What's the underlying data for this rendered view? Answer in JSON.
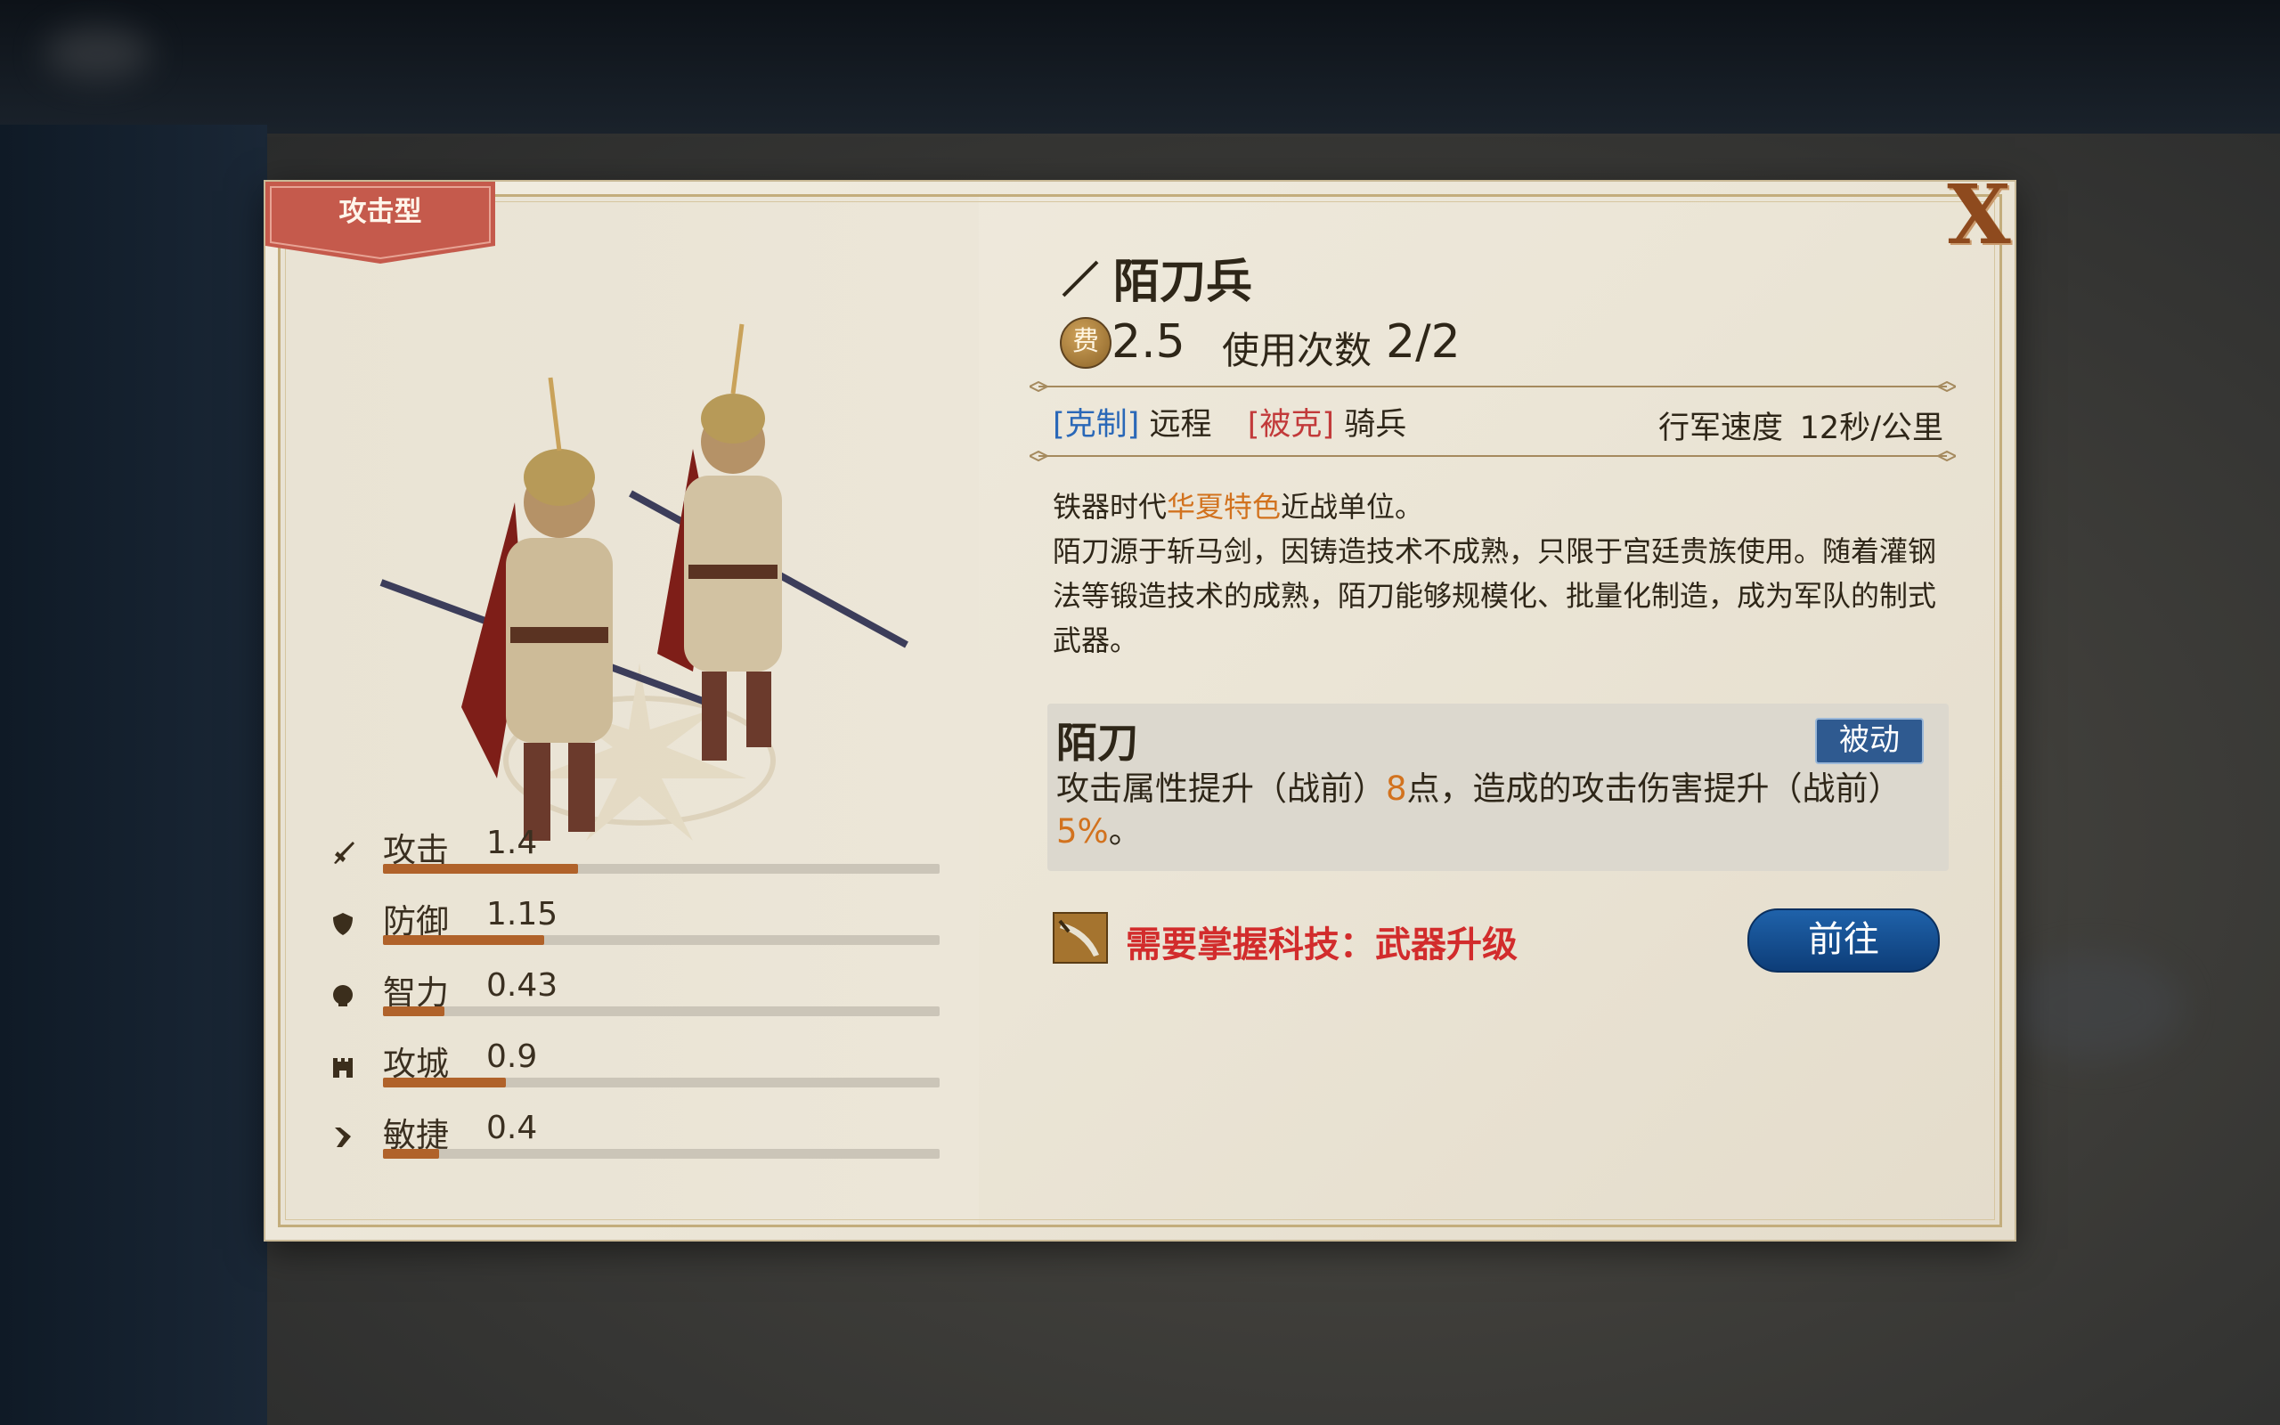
{
  "unit": {
    "type_label": "攻击型",
    "name": "陌刀兵",
    "cost_icon": "费",
    "cost": "2.5",
    "uses_label": "使用次数",
    "uses_value": "2/2",
    "counters_tag": "[克制]",
    "counters_target": "远程",
    "countered_tag": "[被克]",
    "countered_target": "骑兵",
    "speed_label": "行军速度",
    "speed_value": "12秒/公里"
  },
  "description": {
    "line1_pre": "铁器时代",
    "line1_highlight": "华夏特色",
    "line1_post": "近战单位。",
    "body": "陌刀源于斩马剑，因铸造技术不成熟，只限于宫廷贵族使用。随着灌钢法等锻造技术的成熟，陌刀能够规模化、批量化制造，成为军队的制式武器。"
  },
  "skill": {
    "name": "陌刀",
    "badge": "被动",
    "desc_pre": "攻击属性提升（战前）",
    "desc_value1": "8",
    "desc_mid": "点，造成的攻击伤害提升（战前）",
    "desc_value2": "5%",
    "desc_post": "。"
  },
  "tech": {
    "requirement": "需要掌握科技：武器升级",
    "go_button": "前往"
  },
  "stats": [
    {
      "label": "攻击",
      "value": "1.4",
      "fill": 0.35,
      "icon": "sword-icon"
    },
    {
      "label": "防御",
      "value": "1.15",
      "fill": 0.29,
      "icon": "shield-icon"
    },
    {
      "label": "智力",
      "value": "0.43",
      "fill": 0.11,
      "icon": "brain-icon"
    },
    {
      "label": "攻城",
      "value": "0.9",
      "fill": 0.22,
      "icon": "tower-icon"
    },
    {
      "label": "敏捷",
      "value": "0.4",
      "fill": 0.1,
      "icon": "boot-icon"
    }
  ],
  "close_label": "X",
  "colors": {
    "banner": "#c55a4c",
    "stat_fill": "#b0622a",
    "highlight": "#d2721e",
    "tech_text": "#d22c2c",
    "button_blue": "#1a5598"
  }
}
